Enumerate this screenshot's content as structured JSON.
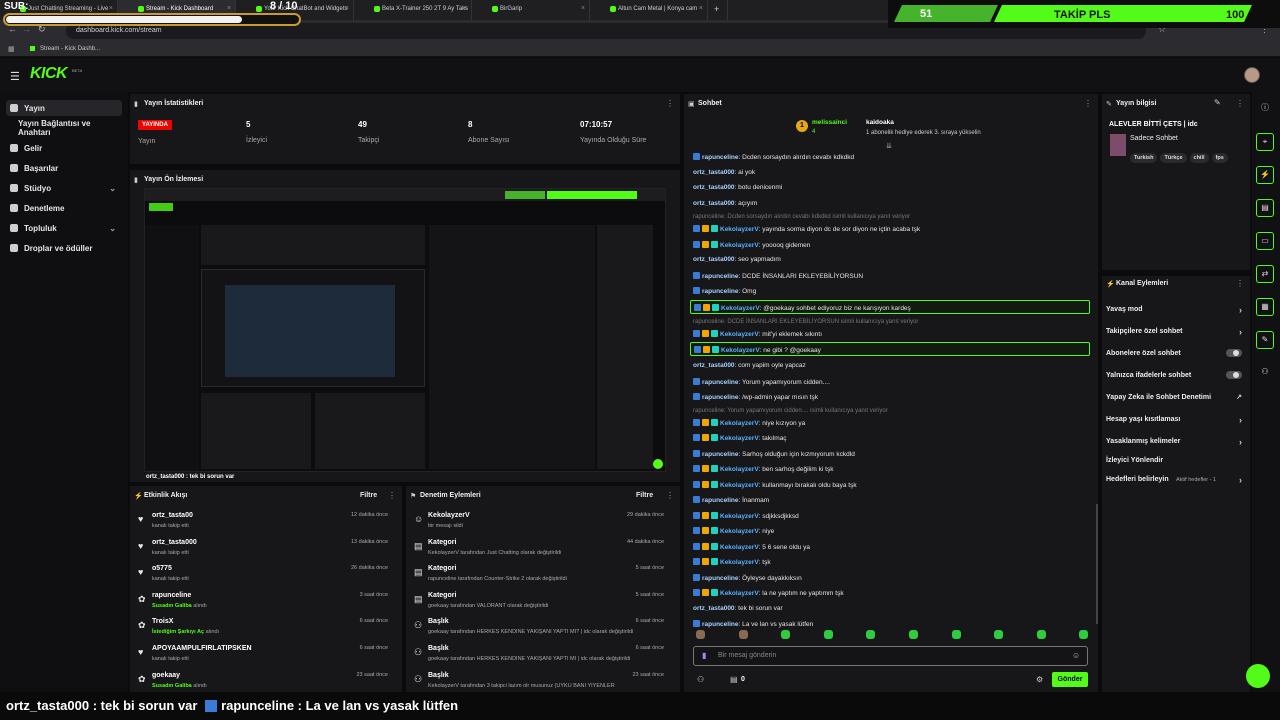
{
  "browser": {
    "tabs": [
      {
        "label": "Just Chatting Streaming - Live"
      },
      {
        "label": "Stream - Kick Dashboard"
      },
      {
        "label": "Your Kick ChatBot and Widgets"
      },
      {
        "label": "Beta X-Trainer 250 2T 9 Ay Taks"
      },
      {
        "label": "BirGarip"
      },
      {
        "label": "Altun Cam Metal | Konya cam"
      }
    ],
    "url": "dashboard.kick.com/stream",
    "bookmark": "Stream - Kick Dashb..."
  },
  "overlay": {
    "sub_label": "SUB:",
    "sub_count": "8 / 10",
    "follow_current": "51",
    "follow_text": "TAKİP PLS",
    "follow_goal": "100"
  },
  "header": {
    "logo": "KICK",
    "logo_sup": "BETA"
  },
  "sidebar": {
    "items": [
      {
        "label": "Yayın"
      },
      {
        "label": "Yayın Bağlantısı ve Anahtarı"
      },
      {
        "label": "Gelir"
      },
      {
        "label": "Başarılar"
      },
      {
        "label": "Stüdyo"
      },
      {
        "label": "Denetleme"
      },
      {
        "label": "Topluluk"
      },
      {
        "label": "Droplar ve ödüller"
      }
    ]
  },
  "stats": {
    "title": "Yayın İstatistikleri",
    "live_badge": "YAYINDA",
    "live_label": "Yayın",
    "viewers": "5",
    "viewers_label": "İzleyici",
    "followers": "49",
    "followers_label": "Takipçi",
    "subs": "8",
    "subs_label": "Abone Sayısı",
    "uptime": "07:10:57",
    "uptime_label": "Yayında Olduğu Süre"
  },
  "preview": {
    "title": "Yayın Ön İzlemesi",
    "caption": "ortz_tasta000 : tek bi sorun var"
  },
  "activity": {
    "title": "Etkinlik Akışı",
    "filter": "Filtre",
    "items": [
      {
        "name": "ortz_tasta00",
        "desc": "kanalı takip etti",
        "hl": "",
        "time": "12 dakika önce"
      },
      {
        "name": "ortz_tasta000",
        "desc": "kanalı takip etti",
        "hl": "",
        "time": "13 dakika önce"
      },
      {
        "name": "o5775",
        "desc": "kanalı takip etti",
        "hl": "",
        "time": "26 dakika önce"
      },
      {
        "name": "rapunceline",
        "desc": " alındı",
        "hl": "Susadın Galiba",
        "time": "3 saat önce"
      },
      {
        "name": "TroisX",
        "desc": " alındı",
        "hl": "İstediğim Şarkıyı Aç",
        "time": "6 saat önce"
      },
      {
        "name": "APOYAAMPULFIRLATIPSKEN",
        "desc": "kanalı takip etti",
        "hl": "",
        "time": "6 saat önce"
      },
      {
        "name": "goekaay",
        "desc": " alındı",
        "hl": "Susadın Galiba",
        "time": "23 saat önce"
      }
    ]
  },
  "moderation": {
    "title": "Denetim Eylemleri",
    "filter": "Filtre",
    "items": [
      {
        "name": "KekolayzerV",
        "desc": "bir mesajı sildi",
        "time": "29 dakika önce"
      },
      {
        "name": "Kategori",
        "desc": "KekolayzerV tarafından Just Chatting olarak değiştirildi",
        "time": "44 dakika önce"
      },
      {
        "name": "Kategori",
        "desc": "rapunceline tarafından Counter-Strike 2 olarak değiştirildi",
        "time": "5 saat önce"
      },
      {
        "name": "Kategori",
        "desc": "goekaay tarafından VALORANT olarak değiştirildi",
        "time": "5 saat önce"
      },
      {
        "name": "Başlık",
        "desc": "goekaay tarafından HERKES KENDİNE YAKIŞANI YAPTI MI? | idc olarak değiştirildi",
        "time": "6 saat önce"
      },
      {
        "name": "Başlık",
        "desc": "goekaay tarafından HERKES KENDİNE YAKIŞANI YAPTI MI | idc olarak değiştirildi",
        "time": "6 saat önce"
      },
      {
        "name": "Başlık",
        "desc": "KekolayzerV tarafından 3 takipci lazım olr musunuz (UYKU BANI YİYENLER",
        "time": "23 saat önce"
      }
    ]
  },
  "chat": {
    "title": "Sohbet",
    "pin_user": "melissainci",
    "pin_user2": "kaidoaka",
    "pin_text": "1 abonelik hediye ederek 3. sıraya yükselin",
    "pin_count": "4",
    "pin_num": "1",
    "messages": [
      {
        "user": "rapunceline",
        "color": "#53fc18",
        "text": ": Dcden sorsaydın alırdın cevabı kdkdkd",
        "reply": "",
        "hl": false
      },
      {
        "user": "ortz_tasta000",
        "color": "#53fc18",
        "text": ": ai yok",
        "reply": "",
        "hl": false
      },
      {
        "user": "ortz_tasta000",
        "color": "#53fc18",
        "text": ": botu denicenmi",
        "reply": "",
        "hl": false
      },
      {
        "user": "ortz_tasta000",
        "color": "#53fc18",
        "text": ": açıyım",
        "reply": "",
        "hl": false
      },
      {
        "user": "KekolayzerV",
        "color": "#53fc18",
        "text": ": yayında sorma diyon dc de sor diyon ne içtin acaba tşk",
        "reply": "rapunceline: Dcden sorsaydın alırdın cevabı kdkdkd isimli kullanıcıya yanıt veriyor",
        "hl": false
      },
      {
        "user": "KekolayzerV",
        "color": "#53fc18",
        "text": ": yooooq gidemen",
        "reply": "",
        "hl": false
      },
      {
        "user": "ortz_tasta000",
        "color": "#53fc18",
        "text": ": seo yapmadım",
        "reply": "",
        "hl": false
      },
      {
        "user": "rapunceline",
        "color": "#53fc18",
        "text": ": DCDE İNSANLARI EKLEYEBİLİYORSUN",
        "reply": "",
        "hl": false
      },
      {
        "user": "rapunceline",
        "color": "#53fc18",
        "text": ": Omg",
        "reply": "",
        "hl": false
      },
      {
        "user": "KekolayzerV",
        "color": "#53fc18",
        "text": ": @goekaay sohbet ediyoruz biz ne karışıyon kardeş",
        "reply": "",
        "hl": true
      },
      {
        "user": "KekolayzerV",
        "color": "#53fc18",
        "text": ": mit'yi eklemek sıkıntı",
        "reply": "rapunceline: DCDE İNSANLARI EKLEYEBİLİYORSUN isimli kullanıcıya yanıt veriyor",
        "hl": false
      },
      {
        "user": "KekolayzerV",
        "color": "#53fc18",
        "text": ": ne gibi ? @goekaay",
        "reply": "",
        "hl": true
      },
      {
        "user": "ortz_tasta000",
        "color": "#53fc18",
        "text": ": com yapim oyle yapcaz",
        "reply": "",
        "hl": false
      },
      {
        "user": "rapunceline",
        "color": "#53fc18",
        "text": ": Yorum yapamıyorum cidden....",
        "reply": "",
        "hl": false
      },
      {
        "user": "rapunceline",
        "color": "#53fc18",
        "text": ": /wp-admin yapar mısın tşk",
        "reply": "",
        "hl": false
      },
      {
        "user": "KekolayzerV",
        "color": "#53fc18",
        "text": ": niye kızıyon ya",
        "reply": "rapunceline: Yorum yapamıyorum cidden.... isimli kullanıcıya yanıt veriyor",
        "hl": false
      },
      {
        "user": "KekolayzerV",
        "color": "#53fc18",
        "text": ": takılmaç",
        "reply": "",
        "hl": false
      },
      {
        "user": "rapunceline",
        "color": "#53fc18",
        "text": ": Sarhoş olduğun için kızmıyorum kckdld",
        "reply": "",
        "hl": false
      },
      {
        "user": "KekolayzerV",
        "color": "#53fc18",
        "text": ": ben sarhoş değilim ki tşk",
        "reply": "",
        "hl": false
      },
      {
        "user": "KekolayzerV",
        "color": "#53fc18",
        "text": ": kullanmayı bırakalı oldu baya tşk",
        "reply": "",
        "hl": false
      },
      {
        "user": "rapunceline",
        "color": "#53fc18",
        "text": ": İnanmam",
        "reply": "",
        "hl": false
      },
      {
        "user": "KekolayzerV",
        "color": "#53fc18",
        "text": ": sdjkksdjkksd",
        "reply": "",
        "hl": false
      },
      {
        "user": "KekolayzerV",
        "color": "#53fc18",
        "text": ": niye",
        "reply": "",
        "hl": false
      },
      {
        "user": "KekolayzerV",
        "color": "#53fc18",
        "text": ": 5 6 sene oldu ya",
        "reply": "",
        "hl": false
      },
      {
        "user": "KekolayzerV",
        "color": "#53fc18",
        "text": ": tşk",
        "reply": "",
        "hl": false
      },
      {
        "user": "rapunceline",
        "color": "#53fc18",
        "text": ": Öyleyse dayakkıksın",
        "reply": "",
        "hl": false
      },
      {
        "user": "KekolayzerV",
        "color": "#53fc18",
        "text": ": la ne yaptım ne yaptımm tşk",
        "reply": "",
        "hl": false
      },
      {
        "user": "ortz_tasta000",
        "color": "#53fc18",
        "text": ": tek bi sorun var",
        "reply": "",
        "hl": false
      },
      {
        "user": "rapunceline",
        "color": "#53fc18",
        "text": ": La ve lan vs yasak lütfen",
        "reply": "",
        "hl": false
      }
    ],
    "input_placeholder": "Bir mesaj gönderin",
    "send": "Gönder",
    "viewers_count": "0"
  },
  "stream_info": {
    "title": "Yayın bilgisi",
    "stream_title": "ALEVLER BİTTİ ÇETS | idc",
    "category": "Sadece Sohbet",
    "tags": [
      "Turkish",
      "Türkçe",
      "chill",
      "fps"
    ]
  },
  "channel_actions": {
    "title": "Kanal Eylemleri",
    "items": [
      {
        "label": "Yavaş mod",
        "kind": "chevron"
      },
      {
        "label": "Takipçilere özel sohbet",
        "kind": "chevron"
      },
      {
        "label": "Abonelere özel sohbet",
        "kind": "toggle"
      },
      {
        "label": "Yalnızca ifadelerle sohbet",
        "kind": "toggle"
      },
      {
        "label": "Yapay Zeka ile Sohbet Denetimi",
        "kind": "external"
      },
      {
        "label": "Hesap yaşı kısıtlaması",
        "kind": "chevron"
      },
      {
        "label": "Yasaklanmış kelimeler",
        "kind": "chevron"
      },
      {
        "label": "İzleyici Yönlendir",
        "kind": "none"
      },
      {
        "label": "Hedefleri belirleyin",
        "kind": "chevron"
      }
    ],
    "goals_note": "Aktif hedefler - 1"
  },
  "bottom_caption": {
    "user1": "ortz_tasta000",
    "text1": " : tek bi sorun var ",
    "user2": "rapunceline",
    "text2": " : La ve lan vs yasak lütfen"
  }
}
